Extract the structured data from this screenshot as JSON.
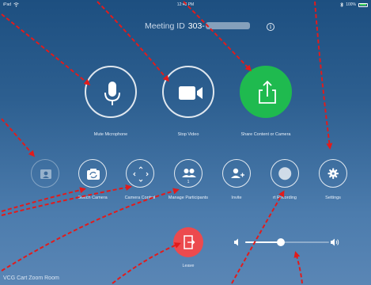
{
  "status_bar": {
    "device": "iPad",
    "time": "12:48 PM",
    "battery": "100%"
  },
  "meeting": {
    "id_label": "Meeting ID",
    "id_value": "303-"
  },
  "main_controls": [
    {
      "label": "Mute Microphone",
      "icon": "microphone-icon"
    },
    {
      "label": "Stop Video",
      "icon": "video-camera-icon"
    },
    {
      "label": "Share Content or Camera",
      "icon": "share-upload-icon",
      "color": "#1fba4f"
    }
  ],
  "secondary_controls": [
    {
      "label": "",
      "icon": "contact-card-icon",
      "enabled": false
    },
    {
      "label": "Switch Camera",
      "icon": "switch-camera-icon",
      "enabled": true
    },
    {
      "label": "Camera Control",
      "icon": "direction-pad-icon",
      "enabled": true
    },
    {
      "label": "Manage Participants",
      "icon": "participants-icon",
      "badge": "1",
      "enabled": true
    },
    {
      "label": "Invite",
      "icon": "add-person-icon",
      "enabled": true
    },
    {
      "label": "rt Recording",
      "icon": "record-icon",
      "enabled": true
    },
    {
      "label": "Settings",
      "icon": "gear-icon",
      "enabled": true
    }
  ],
  "leave": {
    "label": "Leave",
    "color": "#ec4a4e"
  },
  "volume": {
    "level": 0.42
  },
  "room_name": "VCG Cart Zoom Room",
  "annotations": {
    "arrow_color": "#e21b1b"
  }
}
